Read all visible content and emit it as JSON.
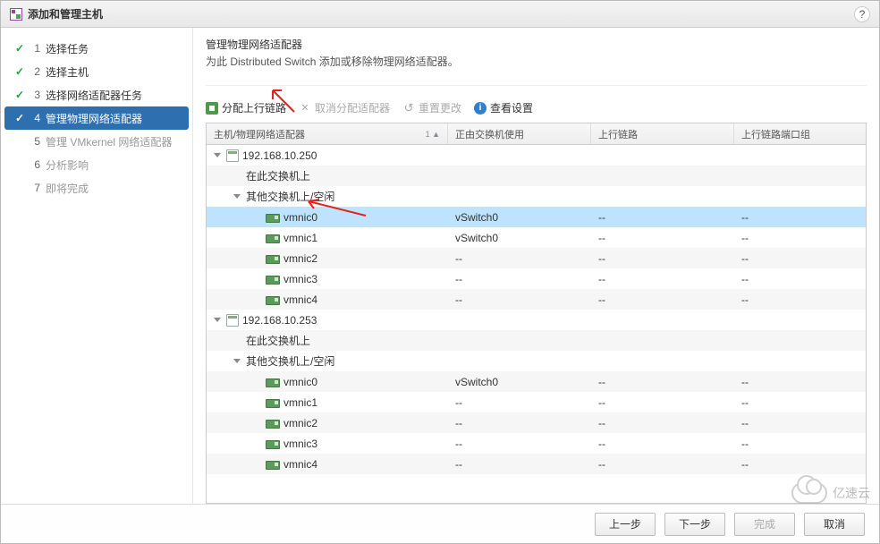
{
  "dialog": {
    "title": "添加和管理主机"
  },
  "steps": [
    {
      "num": "1",
      "label": "选择任务",
      "state": "done"
    },
    {
      "num": "2",
      "label": "选择主机",
      "state": "done"
    },
    {
      "num": "3",
      "label": "选择网络适配器任务",
      "state": "done"
    },
    {
      "num": "4",
      "label": "管理物理网络适配器",
      "state": "active"
    },
    {
      "num": "5",
      "label": "管理 VMkernel 网络适配器",
      "state": "future"
    },
    {
      "num": "6",
      "label": "分析影响",
      "state": "future"
    },
    {
      "num": "7",
      "label": "即将完成",
      "state": "future"
    }
  ],
  "content": {
    "heading": "管理物理网络适配器",
    "subheading": "为此 Distributed Switch 添加或移除物理网络适配器。"
  },
  "toolbar": {
    "assign": "分配上行链路",
    "unassign": "取消分配适配器",
    "reset": "重置更改",
    "view": "查看设置"
  },
  "columns": {
    "c0": "主机/物理网络适配器",
    "c1": "正由交换机使用",
    "c2": "上行链路",
    "c3": "上行链路端口组"
  },
  "rows": [
    {
      "type": "host",
      "indent": 0,
      "expanded": true,
      "label": "192.168.10.250"
    },
    {
      "type": "group",
      "indent": 1,
      "label": "在此交换机上"
    },
    {
      "type": "group",
      "indent": 1,
      "expanded": true,
      "label": "其他交换机上/空闲"
    },
    {
      "type": "nic",
      "indent": 2,
      "label": "vmnic0",
      "c1": "vSwitch0",
      "c2": "--",
      "c3": "--",
      "selected": true
    },
    {
      "type": "nic",
      "indent": 2,
      "label": "vmnic1",
      "c1": "vSwitch0",
      "c2": "--",
      "c3": "--"
    },
    {
      "type": "nic",
      "indent": 2,
      "label": "vmnic2",
      "c1": "--",
      "c2": "--",
      "c3": "--"
    },
    {
      "type": "nic",
      "indent": 2,
      "label": "vmnic3",
      "c1": "--",
      "c2": "--",
      "c3": "--"
    },
    {
      "type": "nic",
      "indent": 2,
      "label": "vmnic4",
      "c1": "--",
      "c2": "--",
      "c3": "--"
    },
    {
      "type": "host",
      "indent": 0,
      "expanded": true,
      "label": "192.168.10.253"
    },
    {
      "type": "group",
      "indent": 1,
      "label": "在此交换机上"
    },
    {
      "type": "group",
      "indent": 1,
      "expanded": true,
      "label": "其他交换机上/空闲"
    },
    {
      "type": "nic",
      "indent": 2,
      "label": "vmnic0",
      "c1": "vSwitch0",
      "c2": "--",
      "c3": "--"
    },
    {
      "type": "nic",
      "indent": 2,
      "label": "vmnic1",
      "c1": "--",
      "c2": "--",
      "c3": "--"
    },
    {
      "type": "nic",
      "indent": 2,
      "label": "vmnic2",
      "c1": "--",
      "c2": "--",
      "c3": "--"
    },
    {
      "type": "nic",
      "indent": 2,
      "label": "vmnic3",
      "c1": "--",
      "c2": "--",
      "c3": "--"
    },
    {
      "type": "nic",
      "indent": 2,
      "label": "vmnic4",
      "c1": "--",
      "c2": "--",
      "c3": "--"
    }
  ],
  "footer": {
    "back": "上一步",
    "next": "下一步",
    "finish": "完成",
    "cancel": "取消"
  },
  "watermark": "亿速云"
}
